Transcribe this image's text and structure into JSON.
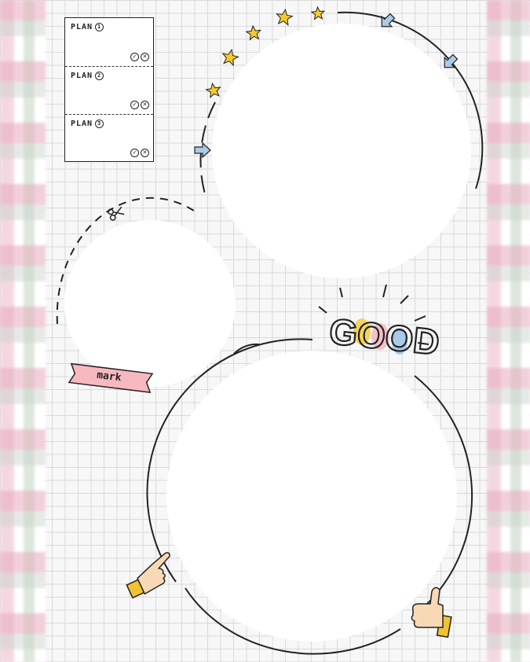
{
  "plan": {
    "rows": [
      {
        "label": "PLAN",
        "number": "1"
      },
      {
        "label": "PLAN",
        "number": "2"
      },
      {
        "label": "PLAN",
        "number": "3"
      }
    ],
    "check_symbol": "✓",
    "cross_symbol": "✕"
  },
  "sticker": {
    "text": "GOOD"
  },
  "tape": {
    "text": "mark"
  },
  "colors": {
    "grid_line": "#d9d9d9",
    "gingham_pink": "#e8aabe",
    "gingham_green": "#c8d2c8",
    "star_yellow": "#f5c92a",
    "arrow_blue": "#a9cbe8",
    "good_yellow": "#f4d35e",
    "good_pink": "#f5c0c8",
    "good_blue": "#a9cbe8",
    "tape_pink": "#f7b8c0",
    "hand_skin": "#f9d9b5",
    "sleeve_yellow": "#f1c232"
  },
  "icons": [
    "star-icon",
    "arrow-icon",
    "scissors-icon",
    "pointing-hand-icon",
    "thumbs-up-icon"
  ]
}
